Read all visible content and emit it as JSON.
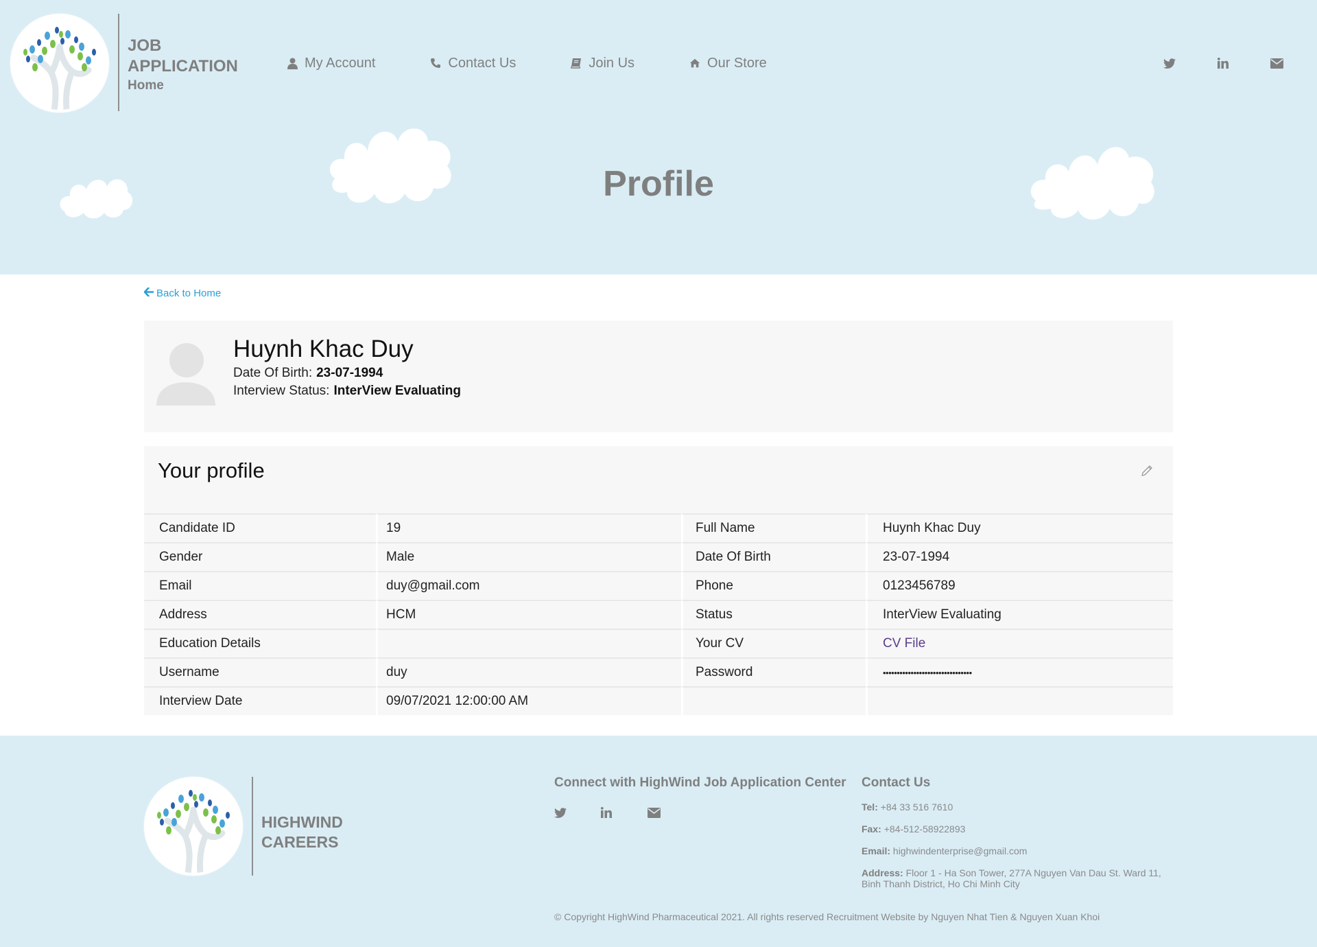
{
  "header": {
    "brand_line1": "JOB",
    "brand_line2": "APPLICATION",
    "brand_sub": "Home",
    "nav": [
      {
        "label": "My Account",
        "icon": "user-icon"
      },
      {
        "label": "Contact Us",
        "icon": "phone-icon"
      },
      {
        "label": "Join Us",
        "icon": "book-icon"
      },
      {
        "label": "Our Store",
        "icon": "home-icon"
      }
    ],
    "social": [
      "twitter-icon",
      "linkedin-icon",
      "envelope-icon"
    ],
    "page_title": "Profile",
    "background_color": "#daedf5"
  },
  "back_link": "Back to Home",
  "summary": {
    "name": "Huynh Khac Duy",
    "dob_label": "Date Of Birth:",
    "dob_value": "23-07-1994",
    "status_label": "Interview Status:",
    "status_value": "InterView Evaluating"
  },
  "profile": {
    "title": "Your profile",
    "rows": [
      {
        "l1": "Candidate ID",
        "v1": "19",
        "l2": "Full Name",
        "v2": "Huynh Khac Duy"
      },
      {
        "l1": "Gender",
        "v1": "Male",
        "l2": "Date Of Birth",
        "v2": "23-07-1994"
      },
      {
        "l1": "Email",
        "v1": "duy@gmail.com",
        "l2": "Phone",
        "v2": "0123456789"
      },
      {
        "l1": "Address",
        "v1": "HCM",
        "l2": "Status",
        "v2": "InterView Evaluating"
      },
      {
        "l1": "Education Details",
        "v1": "",
        "l2": "Your CV",
        "v2": "CV File"
      },
      {
        "l1": "Username",
        "v1": "duy",
        "l2": "Password",
        "v2": "••••••••••••••••••••••••••••••••"
      },
      {
        "l1": "Interview Date",
        "v1": "09/07/2021 12:00:00 AM",
        "l2": "",
        "v2": ""
      }
    ]
  },
  "footer": {
    "brand_line1": "HIGHWIND",
    "brand_line2": "CAREERS",
    "connect_title": "Connect with HighWind Job Application Center",
    "contact_title": "Contact Us",
    "tel_label": "Tel:",
    "tel": "+84 33 516 7610",
    "fax_label": "Fax:",
    "fax": "+84-512-58922893",
    "email_label": "Email:",
    "email": "highwindenterprise@gmail.com",
    "address_label": "Address:",
    "address": "Floor 1 - Ha Son Tower, 277A Nguyen Van Dau St. Ward 11, Binh Thanh District, Ho Chi Minh City",
    "copyright": "© Copyright HighWind Pharmaceutical 2021. All rights reserved Recruitment Website by Nguyen Nhat Tien & Nguyen Xuan Khoi"
  }
}
